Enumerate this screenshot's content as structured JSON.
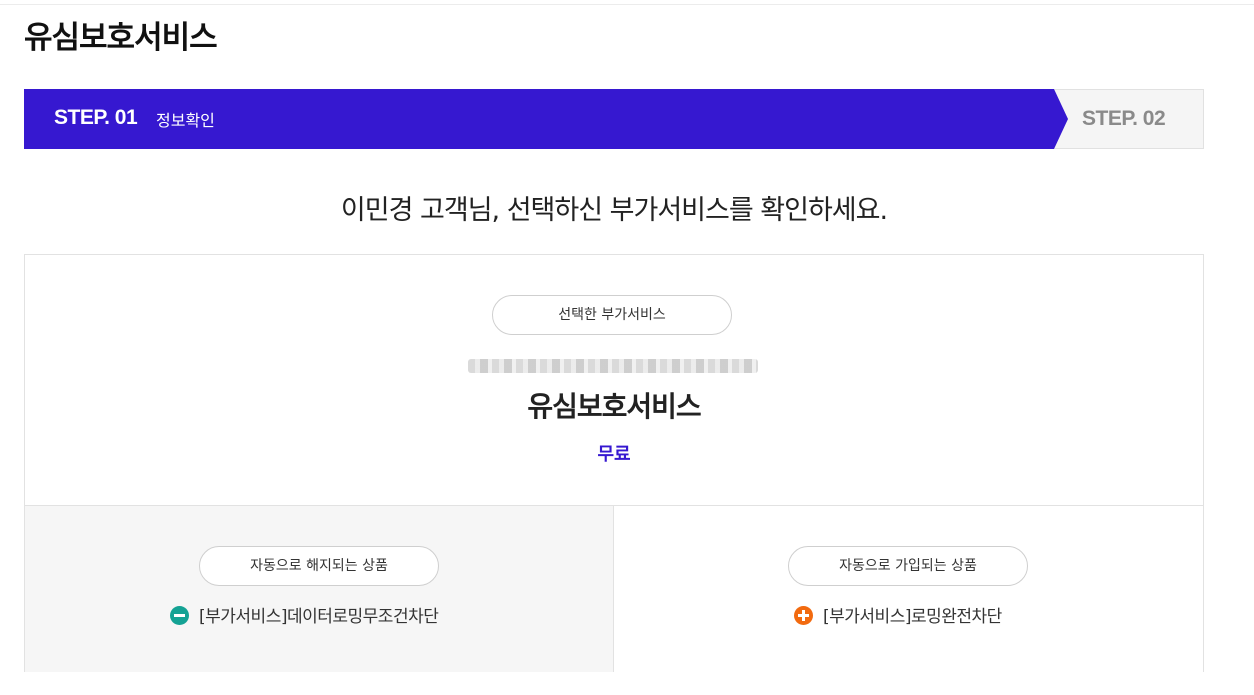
{
  "page": {
    "title": "유심보호서비스"
  },
  "steps": [
    {
      "num": "STEP. 01",
      "label": "정보확인"
    },
    {
      "num": "STEP. 02",
      "label": ""
    }
  ],
  "headline": "이민경 고객님, 선택하신 부가서비스를 확인하세요.",
  "selected": {
    "pill_label": "선택한 부가서비스",
    "service_name": "유심보호서비스",
    "price": "무료"
  },
  "removed": {
    "pill_label": "자동으로 해지되는 상품",
    "item": "[부가서비스]데이터로밍무조건차단",
    "icon": "minus-circle-icon"
  },
  "added": {
    "pill_label": "자동으로 가입되는 상품",
    "item": "[부가서비스]로밍완전차단",
    "icon": "plus-circle-icon"
  },
  "colors": {
    "accent": "#3618d0",
    "minus": "#14a294",
    "plus": "#f26a0f"
  }
}
